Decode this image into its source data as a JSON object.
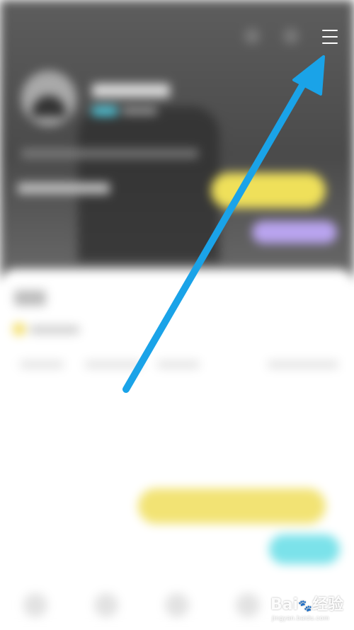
{
  "header": {
    "menu_icon": "hamburger-menu-icon"
  },
  "annotation": {
    "arrow_color": "#1aa3e8"
  },
  "watermark": {
    "main": "Bai",
    "paw": "🐾",
    "suffix": "经验",
    "sub": "jingyan.baidu.com"
  },
  "colors": {
    "accent_yellow": "#efe05a",
    "accent_purple": "#b9a4ef",
    "accent_cyan": "#7be2ea"
  }
}
